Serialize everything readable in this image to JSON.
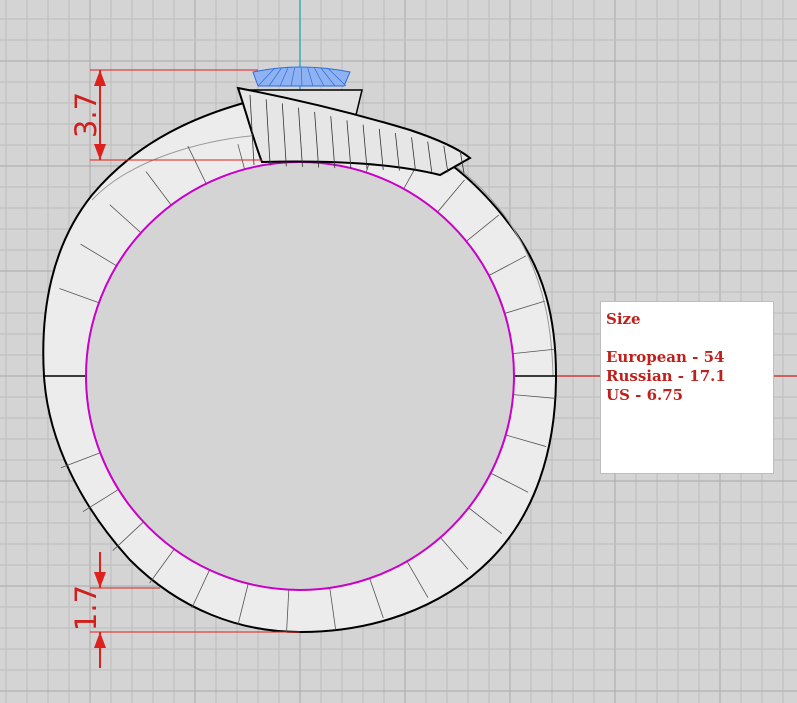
{
  "dimensions": {
    "top_thickness": "3.7",
    "bottom_thickness": "1.7"
  },
  "size_panel": {
    "title": "Size",
    "european": "European - 54",
    "russian": "Russian - 17.1",
    "us": "US - 6.75"
  },
  "colors": {
    "background": "#d4d4d4",
    "grid_minor": "#bcbcbc",
    "grid_major": "#a9a9a9",
    "axis_x": "#cc1f1a",
    "axis_y": "#1aa3a3",
    "inner_circle": "#c800c8",
    "gem": "#7fa7ee",
    "dimension": "#e0201c",
    "panel_text": "#c0201c"
  }
}
